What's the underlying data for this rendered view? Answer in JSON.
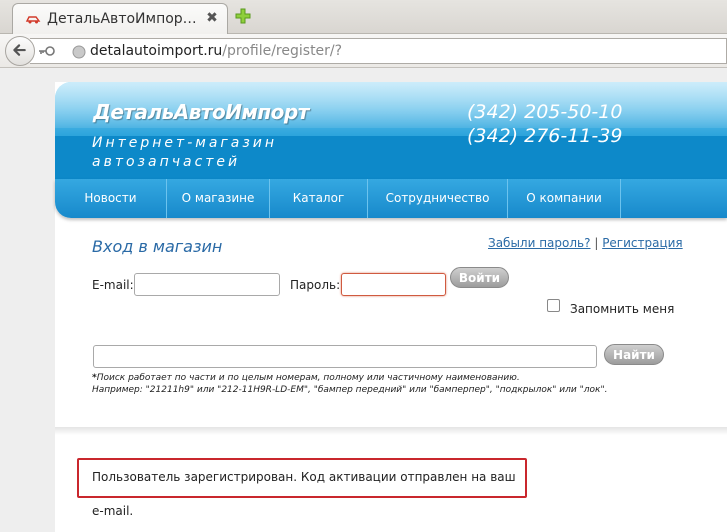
{
  "browser": {
    "tab_title": "ДетальАвтоИмпор…",
    "url_host": "detalautoimport.ru",
    "url_path": "/profile/register/?"
  },
  "site": {
    "logo": "ДетальАвтоИмпорт",
    "tagline_line1": "Интернет-магазин",
    "tagline_line2": "автозапчастей",
    "phone1": "(342) 205-50-10",
    "phone2": "(342) 276-11-39",
    "menu": [
      "Новости",
      "О магазине",
      "Каталог",
      "Сотрудничество",
      "О компании"
    ]
  },
  "login": {
    "title": "Вход в магазин",
    "forgot_link": "Забыли пароль?",
    "separator": "|",
    "register_link": "Регистрация",
    "email_label": "E-mail:",
    "password_label": "Пароль:",
    "login_button": "Войти",
    "remember_label": "Запомнить меня"
  },
  "search": {
    "button": "Найти",
    "note_asterisk": "*",
    "note_line1": "Поиск работает по части и по целым номерам, полному или частичному наименованию.",
    "note_line2": "Например: \"21211h9\" или \"212-11H9R-LD-EM\", \"бампер передний\" или \"бамперпер\", \"подкрылок\" или \"лок\"."
  },
  "status_message": "Пользователь зарегистрирован. Код активации отправлен на ваш e-mail.",
  "colors": {
    "accent": "#158fd0",
    "link": "#2a6aa6",
    "error_border": "#c9272d"
  }
}
